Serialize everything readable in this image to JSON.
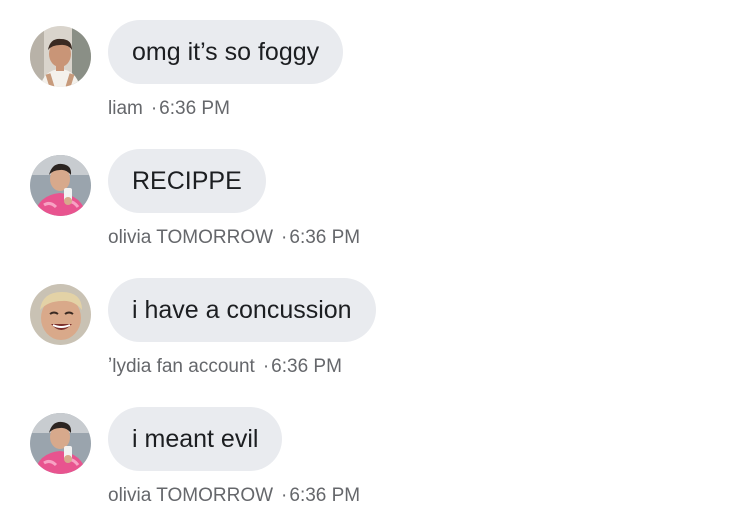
{
  "messages": [
    {
      "text": "omg it’s so foggy",
      "sender": "liam",
      "separator": "·",
      "time": "6:36 PM",
      "avatar": "boy-tank-top-avatar"
    },
    {
      "text": "RECIPPE",
      "sender": "olivia TOMORROW",
      "separator": "·",
      "time": "6:36 PM",
      "avatar": "pink-shirt-selfie-avatar"
    },
    {
      "text": "i have a concussion",
      "sender": "ʼlydia fan account",
      "separator": "·",
      "time": "6:36 PM",
      "avatar": "laughing-blond-avatar"
    },
    {
      "text": "i meant evil",
      "sender": "olivia TOMORROW",
      "separator": "·",
      "time": "6:36 PM",
      "avatar": "pink-shirt-selfie-avatar"
    }
  ],
  "colors": {
    "bubble": "#e9ebef",
    "text": "#1c1e21",
    "meta": "#65676b"
  }
}
